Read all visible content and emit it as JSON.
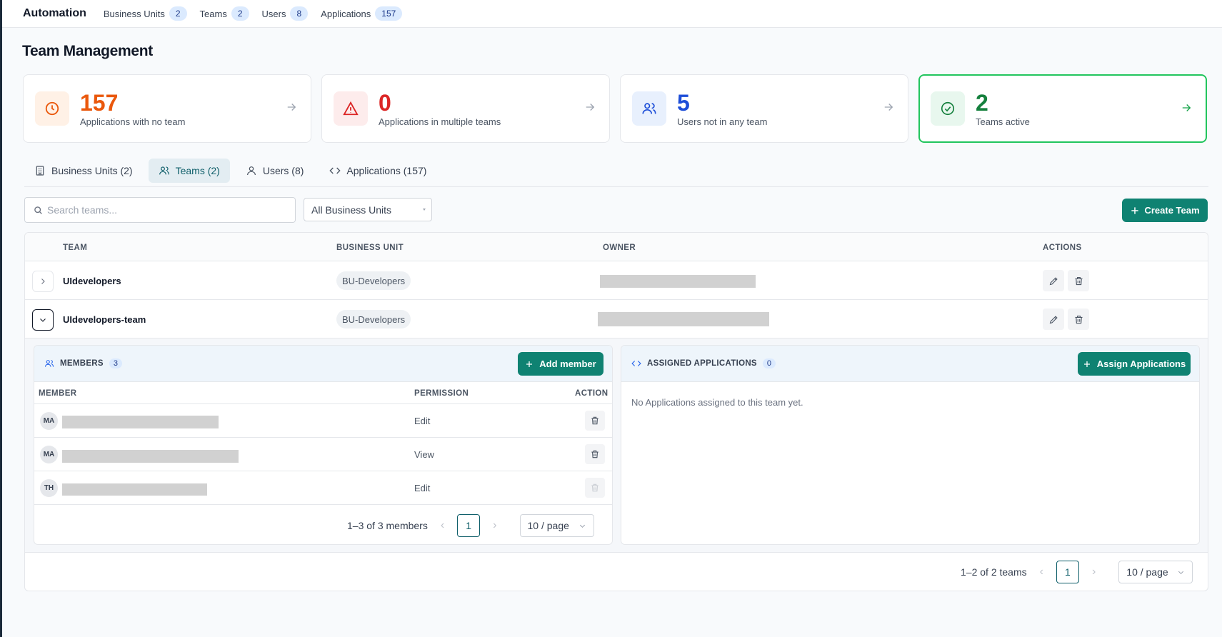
{
  "topbar": {
    "brand": "Automation",
    "nav": [
      {
        "label": "Business Units",
        "count": "2"
      },
      {
        "label": "Teams",
        "count": "2"
      },
      {
        "label": "Users",
        "count": "8"
      },
      {
        "label": "Applications",
        "count": "157"
      }
    ]
  },
  "page": {
    "title": "Team Management"
  },
  "cards": [
    {
      "value": "157",
      "label": "Applications with no team",
      "color": "#ea580c",
      "bg": "#fff1e6"
    },
    {
      "value": "0",
      "label": "Applications in multiple teams",
      "color": "#dc2626",
      "bg": "#fdecec"
    },
    {
      "value": "5",
      "label": "Users not in any team",
      "color": "#1d4ed8",
      "bg": "#e8f0fd"
    },
    {
      "value": "2",
      "label": "Teams active",
      "color": "#15803d",
      "bg": "#e8f7ee"
    }
  ],
  "tabs": [
    {
      "label": "Business Units (2)",
      "icon": "building-icon"
    },
    {
      "label": "Teams (2)",
      "icon": "users-icon",
      "selected": true
    },
    {
      "label": "Users (8)",
      "icon": "user-icon"
    },
    {
      "label": "Applications (157)",
      "icon": "code-icon"
    }
  ],
  "filters": {
    "search_placeholder": "Search teams...",
    "business_unit_selected": "All Business Units",
    "create_label": "Create Team"
  },
  "table": {
    "columns": [
      "TEAM",
      "BUSINESS UNIT",
      "OWNER",
      "ACTIONS"
    ],
    "rows": [
      {
        "team": "UIdevelopers",
        "business_unit": "BU-Developers",
        "expanded": false
      },
      {
        "team": "UIdevelopers-team",
        "business_unit": "BU-Developers",
        "expanded": true
      }
    ],
    "pagination": {
      "summary": "1–2 of 2 teams",
      "page": "1",
      "per_page": "10 / page"
    }
  },
  "members_panel": {
    "title": "MEMBERS",
    "count": "3",
    "add_label": "Add member",
    "columns": [
      "MEMBER",
      "PERMISSION",
      "ACTION"
    ],
    "members": [
      {
        "initials": "MA",
        "permission": "Edit"
      },
      {
        "initials": "MA",
        "permission": "View"
      },
      {
        "initials": "TH",
        "permission": "Edit"
      }
    ],
    "pagination": {
      "summary": "1–3 of 3 members",
      "page": "1",
      "per_page": "10 / page"
    }
  },
  "apps_panel": {
    "title": "ASSIGNED APPLICATIONS",
    "count": "0",
    "assign_label": "Assign Applications",
    "empty_message": "No Applications assigned to this team yet."
  },
  "colors": {
    "accent": "#0f8272",
    "active_border": "#22c55e"
  }
}
